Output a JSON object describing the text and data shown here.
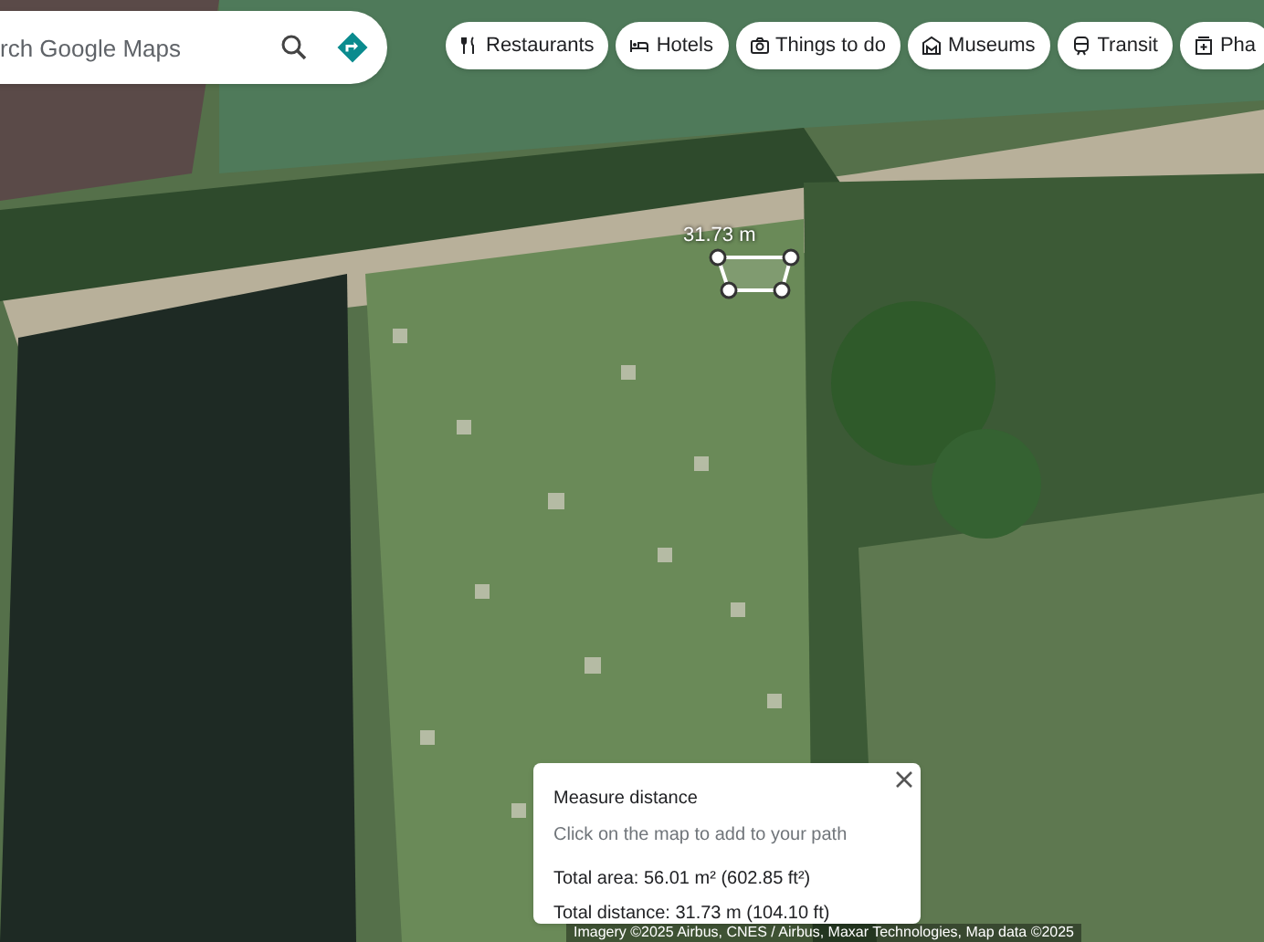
{
  "search": {
    "placeholder": "rch Google Maps"
  },
  "chips": [
    {
      "label": "Restaurants"
    },
    {
      "label": "Hotels"
    },
    {
      "label": "Things to do"
    },
    {
      "label": "Museums"
    },
    {
      "label": "Transit"
    },
    {
      "label": "Pha"
    }
  ],
  "map": {
    "measure_label": "31.73 m"
  },
  "measure_panel": {
    "title": "Measure distance",
    "hint": "Click on the map to add to your path",
    "total_area": "Total area: 56.01 m² (602.85 ft²)",
    "total_distance": "Total distance: 31.73 m (104.10 ft)"
  },
  "attribution": "Imagery ©2025 Airbus, CNES / Airbus, Maxar Technologies, Map data ©2025"
}
